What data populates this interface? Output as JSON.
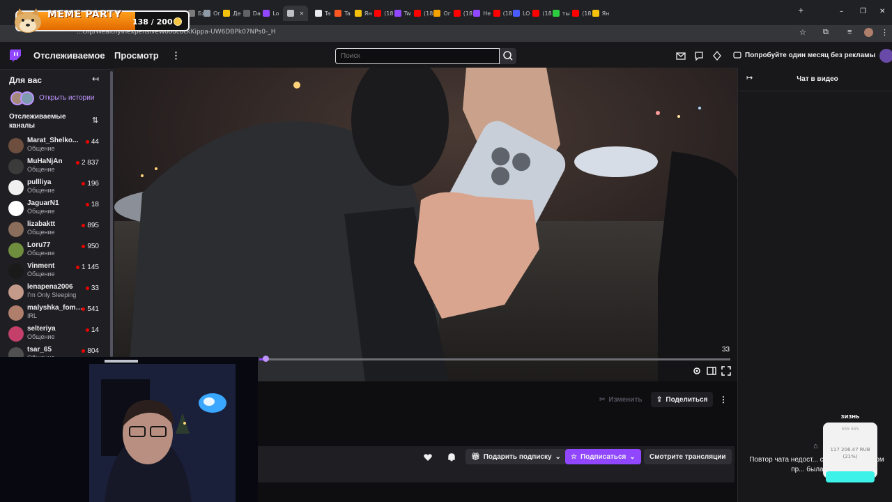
{
  "browser": {
    "tabs": [
      {
        "label": "Ог",
        "color": "#8e9aa6"
      },
      {
        "label": "Де",
        "color": "#f4c20d"
      },
      {
        "label": "Da",
        "color": "#5f6368"
      },
      {
        "label": "Lo",
        "color": "#9146ff"
      },
      {
        "label": "",
        "color": "#bdc1c6"
      },
      {
        "label": "Ta",
        "color": "#e8eaed"
      },
      {
        "label": "Ta",
        "color": "#ff5722"
      },
      {
        "label": "Ян",
        "color": "#f4c20d"
      },
      {
        "label": "(18",
        "color": "#ff0000"
      },
      {
        "label": "Tw",
        "color": "#9146ff"
      },
      {
        "label": "(18",
        "color": "#ff0000"
      },
      {
        "label": "Ог",
        "color": "#f4a300"
      },
      {
        "label": "(18",
        "color": "#ff0000"
      },
      {
        "label": "Не",
        "color": "#9146ff"
      },
      {
        "label": "(18",
        "color": "#ff0000"
      },
      {
        "label": "LO",
        "color": "#4a5cff"
      },
      {
        "label": "(18",
        "color": "#ff0000"
      },
      {
        "label": "ты",
        "color": "#2ecc40"
      },
      {
        "label": "(18",
        "color": "#ff0000"
      },
      {
        "label": "Ян",
        "color": "#f4c20d"
      }
    ],
    "new_tab": "+",
    "minimize": "–",
    "maximize": "❐",
    "close": "✕",
    "url": "...clip/WealthyInexpensiveWoodcockKippa-UW6DBPk07NPs0-_H"
  },
  "meme_overlay": {
    "title": "MEME PARTY",
    "count": "138 / 200",
    "progress": 0.69
  },
  "nav": {
    "following": "Отслеживаемое",
    "browse": "Просмотр",
    "more": "⋮",
    "search_placeholder": "Поиск",
    "promo": "Попробуйте один месяц без рекламы"
  },
  "sidebar": {
    "for_you": "Для вас",
    "open_stories": "Открыть истории",
    "followed_title": "Отслеживаемые каналы",
    "channels": [
      {
        "name": "Marat_Shelko...",
        "category": "Общение",
        "viewers": "44",
        "avatar": "#6e4f3f"
      },
      {
        "name": "MuHaNjAn",
        "category": "Общение",
        "viewers": "2 837",
        "avatar": "#3b3b3b"
      },
      {
        "name": "pullliya",
        "category": "Общение",
        "viewers": "196",
        "avatar": "#f0f0f0"
      },
      {
        "name": "JaguarN1",
        "category": "Общение",
        "viewers": "18",
        "avatar": "#ffffff"
      },
      {
        "name": "lizabaktt",
        "category": "Общение",
        "viewers": "895",
        "avatar": "#8a6d5a"
      },
      {
        "name": "Loru77",
        "category": "Общение",
        "viewers": "950",
        "avatar": "#6f8f3f"
      },
      {
        "name": "Vinment",
        "category": "Общение",
        "viewers": "1 145",
        "avatar": "#1a1a1a"
      },
      {
        "name": "lenapena2006",
        "category": "I'm Only Sleeping",
        "viewers": "33",
        "avatar": "#c49a8a"
      },
      {
        "name": "malyshka_fomina",
        "category": "IRL",
        "viewers": "541",
        "avatar": "#b07f6c"
      },
      {
        "name": "selteriya",
        "category": "Общение",
        "viewers": "14",
        "avatar": "#c43f6a"
      },
      {
        "name": "tsar_65",
        "category": "Общение",
        "viewers": "804",
        "avatar": "#505050"
      }
    ]
  },
  "player": {
    "time": "33",
    "progress": 0.01
  },
  "actions": {
    "edit": "Изменить",
    "share": "Поделиться",
    "more": "⋮"
  },
  "channel_bar": {
    "gift_sub": "Подарить подписку",
    "subscribe": "Подписаться",
    "watch_streams": "Смотрите трансляции"
  },
  "chat": {
    "title": "Чат в видео",
    "message": "Повтор чата недост... связанная с клипом пр... была уда..."
  },
  "donation": {
    "title": "ЗИЗНЬ",
    "goal": "555 555",
    "sum": "117 206.47 RUB",
    "percent": "(21%)"
  },
  "colors": {
    "accent": "#9147ff",
    "live": "#eb0400",
    "meme_orange": "#ff9f1c"
  }
}
